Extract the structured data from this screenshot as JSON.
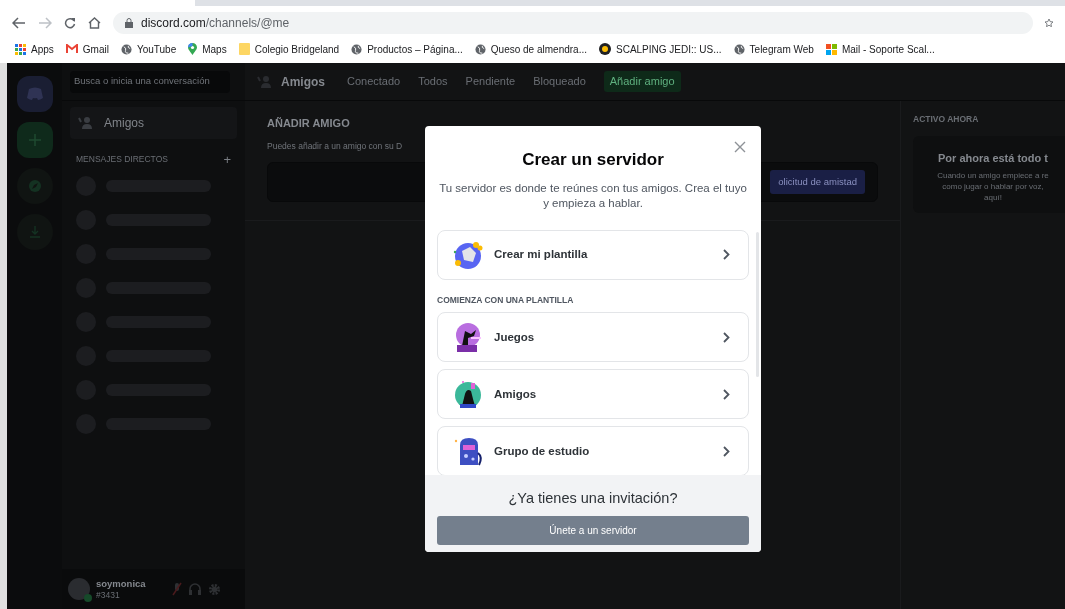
{
  "browser": {
    "url_host": "discord.com",
    "url_path": "/channels/@me",
    "bookmarks": [
      {
        "kind": "apps",
        "label": "Apps"
      },
      {
        "kind": "gmail",
        "label": "Gmail"
      },
      {
        "kind": "globe",
        "label": "YouTube"
      },
      {
        "kind": "maps",
        "label": "Maps"
      },
      {
        "kind": "folder",
        "label": "Colegio Bridgeland"
      },
      {
        "kind": "globe",
        "label": "Productos – Página..."
      },
      {
        "kind": "globe",
        "label": "Queso de almendra..."
      },
      {
        "kind": "coin",
        "label": "SCALPING JEDI:: US..."
      },
      {
        "kind": "globe",
        "label": "Telegram Web"
      },
      {
        "kind": "windows",
        "label": "Mail - Soporte Scal..."
      }
    ]
  },
  "discord": {
    "search_placeholder": "Busca o inicia una conversación",
    "friends_item": "Amigos",
    "dm_header": "MENSAJES DIRECTOS",
    "dm_add": "+",
    "user": {
      "name": "soymonica",
      "tag": "#3431"
    },
    "header_title": "Amigos",
    "tabs": [
      {
        "label": "Conectado",
        "kind": "tab"
      },
      {
        "label": "Todos",
        "kind": "tab"
      },
      {
        "label": "Pendiente",
        "kind": "tab"
      },
      {
        "label": "Bloqueado",
        "kind": "tab"
      },
      {
        "label": "Añadir amigo",
        "kind": "add"
      }
    ],
    "add_friend": {
      "title": "AÑADIR AMIGO",
      "description": "Puedes añadir a un amigo con su D",
      "button": "olicitud de amistad"
    },
    "active_now": {
      "title": "ACTIVO AHORA",
      "heading": "Por ahora está todo t",
      "lines": [
        "Cuando un amigo empiece a re",
        "como jugar o hablar por voz,",
        "aquí!"
      ]
    }
  },
  "modal": {
    "title": "Crear un servidor",
    "subtitle": "Tu servidor es donde te reúnes con tus amigos. Crea el tuyo y empieza a hablar.",
    "first_option": {
      "label": "Crear mi plantilla",
      "kind": "globe"
    },
    "section_label": "COMIENZA CON UNA PLANTILLA",
    "templates": [
      {
        "label": "Juegos",
        "kind": "gaming"
      },
      {
        "label": "Amigos",
        "kind": "friends"
      },
      {
        "label": "Grupo de estudio",
        "kind": "study"
      }
    ],
    "footer_title": "¿Ya tienes una invitación?",
    "join_button": "Únete a un servidor"
  }
}
